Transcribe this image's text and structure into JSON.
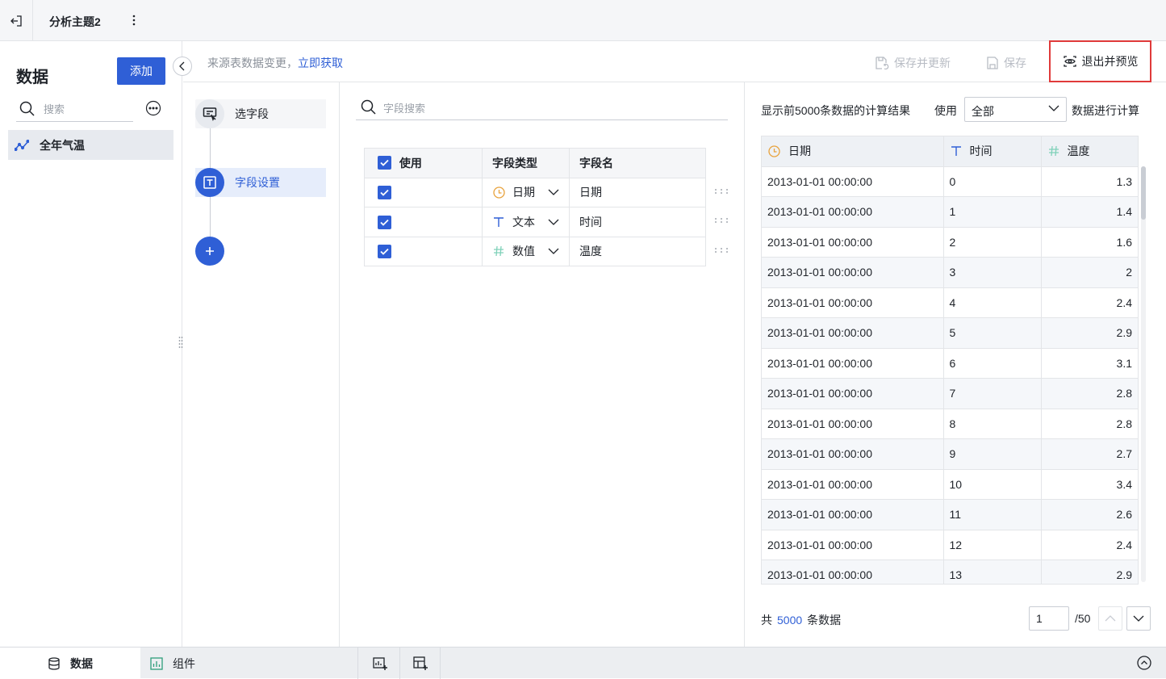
{
  "topbar": {
    "title": "分析主题2"
  },
  "left": {
    "title": "数据",
    "add_label": "添加",
    "search_placeholder": "搜索",
    "dataset": "全年气温"
  },
  "toolbar": {
    "notice_text": "来源表数据变更，",
    "notice_link": "立即获取",
    "save_update": "保存并更新",
    "save": "保存",
    "exit_preview": "退出并预览"
  },
  "steps": {
    "select_fields": "选字段",
    "field_settings": "字段设置"
  },
  "fields": {
    "search_placeholder": "字段搜索",
    "headers": {
      "use": "使用",
      "type": "字段类型",
      "name": "字段名"
    },
    "rows": [
      {
        "type": "日期",
        "name": "日期",
        "icon": "clock-icon"
      },
      {
        "type": "文本",
        "name": "时间",
        "icon": "text-t-icon"
      },
      {
        "type": "数值",
        "name": "温度",
        "icon": "hash-icon"
      }
    ]
  },
  "preview": {
    "head": "显示前5000条数据的计算结果",
    "use_label": "使用",
    "scope": "全部",
    "calc_label": "数据进行计算",
    "columns": [
      "日期",
      "时间",
      "温度"
    ],
    "rows": [
      [
        "2013-01-01 00:00:00",
        "0",
        "1.3"
      ],
      [
        "2013-01-01 00:00:00",
        "1",
        "1.4"
      ],
      [
        "2013-01-01 00:00:00",
        "2",
        "1.6"
      ],
      [
        "2013-01-01 00:00:00",
        "3",
        "2"
      ],
      [
        "2013-01-01 00:00:00",
        "4",
        "2.4"
      ],
      [
        "2013-01-01 00:00:00",
        "5",
        "2.9"
      ],
      [
        "2013-01-01 00:00:00",
        "6",
        "3.1"
      ],
      [
        "2013-01-01 00:00:00",
        "7",
        "2.8"
      ],
      [
        "2013-01-01 00:00:00",
        "8",
        "2.8"
      ],
      [
        "2013-01-01 00:00:00",
        "9",
        "2.7"
      ],
      [
        "2013-01-01 00:00:00",
        "10",
        "3.4"
      ],
      [
        "2013-01-01 00:00:00",
        "11",
        "2.6"
      ],
      [
        "2013-01-01 00:00:00",
        "12",
        "2.4"
      ],
      [
        "2013-01-01 00:00:00",
        "13",
        "2.9"
      ]
    ],
    "total_prefix": "共",
    "total_count": "5000",
    "total_suffix": "条数据",
    "page_current": "1",
    "page_total": "/50"
  },
  "bottom": {
    "data_tab": "数据",
    "widget_tab": "组件"
  },
  "colors": {
    "accent": "#2f5fd6",
    "highlight": "#e03a3a",
    "date_icon": "#e8a23c",
    "number_icon": "#7fd1b9"
  }
}
